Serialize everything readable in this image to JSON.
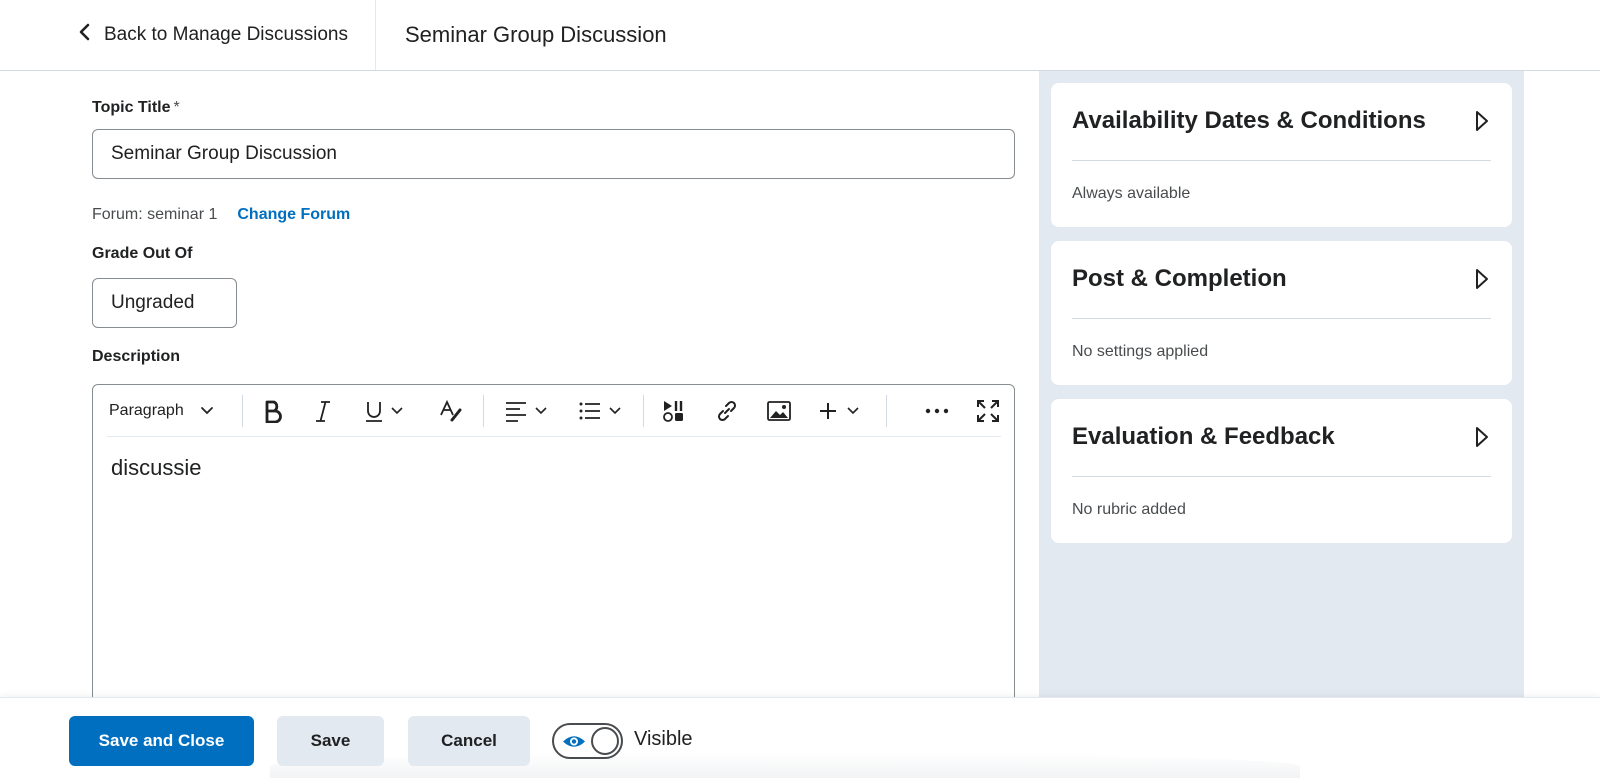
{
  "header": {
    "back_label": "Back to Manage Discussions",
    "title": "Seminar Group Discussion"
  },
  "form": {
    "topic_title_label": "Topic Title",
    "required_marker": "*",
    "topic_title_value": "Seminar Group Discussion",
    "forum_text": "Forum: seminar 1",
    "change_forum_label": "Change Forum",
    "grade_label": "Grade Out Of",
    "grade_value": "Ungraded",
    "description_label": "Description"
  },
  "editor": {
    "block_format": "Paragraph",
    "content": "discussie",
    "tools": [
      "bold-icon",
      "italic-icon",
      "underline-icon",
      "text-style-icon",
      "align-icon",
      "list-icon",
      "media-icon",
      "link-icon",
      "image-icon",
      "insert-icon",
      "more-icon",
      "fullscreen-icon"
    ]
  },
  "sidebar": {
    "cards": [
      {
        "title": "Availability Dates & Conditions",
        "summary": "Always available"
      },
      {
        "title": "Post & Completion",
        "summary": "No settings applied"
      },
      {
        "title": "Evaluation & Feedback",
        "summary": "No rubric added"
      }
    ]
  },
  "footer": {
    "save_close_label": "Save and Close",
    "save_label": "Save",
    "cancel_label": "Cancel",
    "visibility_label": "Visible"
  },
  "colors": {
    "primary": "#006fbf",
    "sidebar_bg": "#e3e9f1",
    "text": "#202122"
  }
}
